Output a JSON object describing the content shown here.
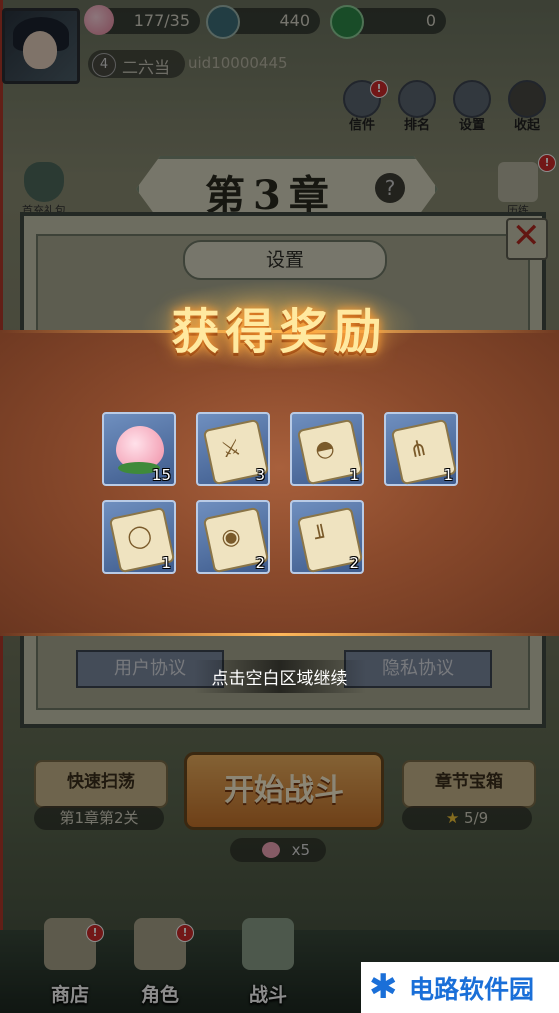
{
  "top": {
    "peach_count": "177/35",
    "coin_count": "440",
    "jade_count": "0",
    "level": "4",
    "player_name": "二六当",
    "uid": "uid10000445"
  },
  "side_buttons": [
    {
      "label": "信件",
      "badge": "!"
    },
    {
      "label": "排名",
      "badge": ""
    },
    {
      "label": "设置",
      "badge": ""
    },
    {
      "label": "收起",
      "badge": ""
    }
  ],
  "left_deco_label": "首充礼包",
  "right_deco_label": "历练",
  "chapter": {
    "title": "第3章",
    "help": "?"
  },
  "settings": {
    "title": "设置",
    "user_agreement": "用户协议",
    "privacy_policy": "隐私协议"
  },
  "reward": {
    "title": "获得奖励",
    "items": [
      {
        "icon": "peach",
        "count": "15"
      },
      {
        "icon": "scroll-swords",
        "count": "3"
      },
      {
        "icon": "scroll-fan",
        "count": "1"
      },
      {
        "icon": "scroll-claw",
        "count": "1"
      },
      {
        "icon": "scroll-ring",
        "count": "1"
      },
      {
        "icon": "scroll-orb",
        "count": "2"
      },
      {
        "icon": "scroll-boot",
        "count": "2"
      }
    ],
    "continue_hint": "点击空白区域继续"
  },
  "bottom": {
    "sweep_label": "快速扫荡",
    "sweep_stage": "第1章第2关",
    "start_label": "开始战斗",
    "start_cost": "x5",
    "chest_label": "章节宝箱",
    "chest_progress": "5/9"
  },
  "nav": [
    {
      "label": "商店",
      "badge": "!"
    },
    {
      "label": "角色",
      "badge": "!"
    },
    {
      "label": "战斗",
      "badge": ""
    }
  ],
  "watermark": "电路软件园",
  "colors": {
    "accent_red": "#cf2a2a",
    "reward_gold": "#ffe9a0",
    "slot_blue": "#4a6aa0"
  }
}
